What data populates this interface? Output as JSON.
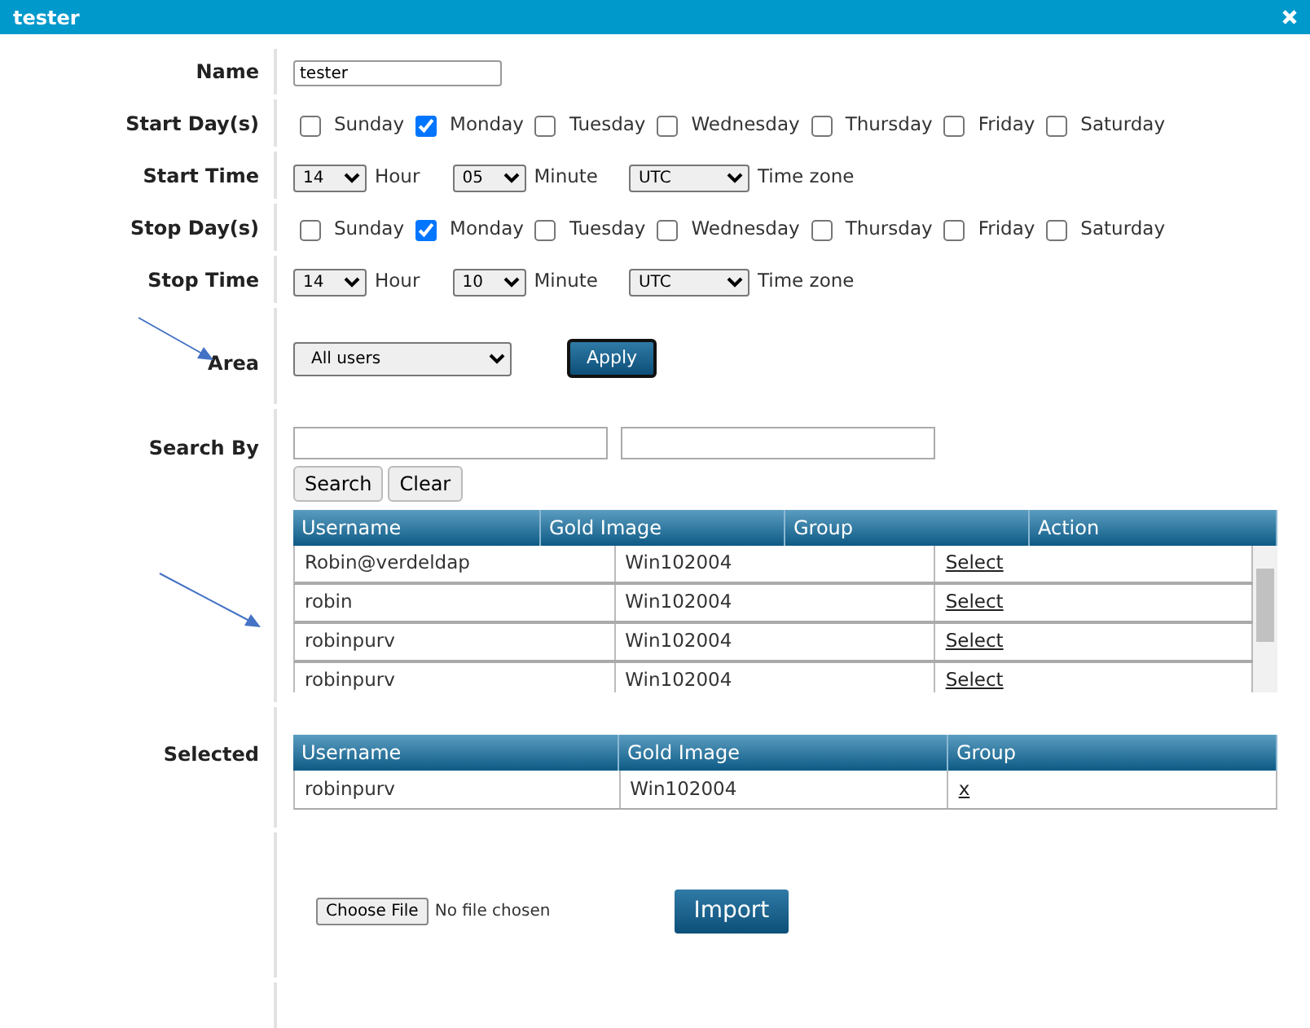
{
  "window": {
    "title": "tester"
  },
  "name": {
    "label": "Name",
    "value": "tester"
  },
  "start_days": {
    "label": "Start Day(s)",
    "days": [
      {
        "label": "Sunday",
        "checked": false
      },
      {
        "label": "Monday",
        "checked": true
      },
      {
        "label": "Tuesday",
        "checked": false
      },
      {
        "label": "Wednesday",
        "checked": false
      },
      {
        "label": "Thursday",
        "checked": false
      },
      {
        "label": "Friday",
        "checked": false
      },
      {
        "label": "Saturday",
        "checked": false
      }
    ]
  },
  "start_time": {
    "label": "Start Time",
    "hour": "14",
    "hour_label": "Hour",
    "minute": "05",
    "minute_label": "Minute",
    "timezone": "UTC",
    "timezone_label": "Time zone"
  },
  "stop_days": {
    "label": "Stop Day(s)",
    "days": [
      {
        "label": "Sunday",
        "checked": false
      },
      {
        "label": "Monday",
        "checked": true
      },
      {
        "label": "Tuesday",
        "checked": false
      },
      {
        "label": "Wednesday",
        "checked": false
      },
      {
        "label": "Thursday",
        "checked": false
      },
      {
        "label": "Friday",
        "checked": false
      },
      {
        "label": "Saturday",
        "checked": false
      }
    ]
  },
  "stop_time": {
    "label": "Stop Time",
    "hour": "14",
    "hour_label": "Hour",
    "minute": "10",
    "minute_label": "Minute",
    "timezone": "UTC",
    "timezone_label": "Time zone"
  },
  "area": {
    "label": "Area",
    "value": "All users",
    "apply": "Apply"
  },
  "search": {
    "label": "Search By",
    "buttons": [
      "Search",
      "Clear"
    ],
    "columns": [
      "Username",
      "Gold Image",
      "Group",
      "Action"
    ],
    "rows": [
      {
        "username": "Robin@verdeldap",
        "gold_image": "Win102004",
        "action": "Select"
      },
      {
        "username": "robin",
        "gold_image": "Win102004",
        "action": "Select"
      },
      {
        "username": "robinpurv",
        "gold_image": "Win102004",
        "action": "Select"
      },
      {
        "username": "robinpurv",
        "gold_image": "Win102004",
        "action": "Select"
      }
    ]
  },
  "selected": {
    "label": "Selected",
    "columns": [
      "Username",
      "Gold Image",
      "Group"
    ],
    "rows": [
      {
        "username": "robinpurv",
        "gold_image": "Win102004",
        "remove": "x"
      }
    ]
  },
  "import": {
    "choose_file": "Choose File",
    "file_status": "No file chosen",
    "button": "Import"
  }
}
